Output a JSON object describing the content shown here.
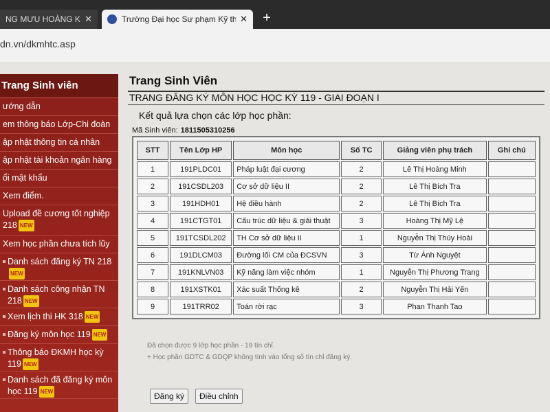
{
  "browser": {
    "tabs": [
      {
        "label": "NG MƯU HOÀNG KẾ -",
        "close": "✕"
      },
      {
        "label": "Trường Đại học Sư phạm Kỹ thuậ",
        "close": "✕"
      }
    ],
    "new_tab": "+",
    "url": "dn.vn/dkmhtc.asp"
  },
  "sidebar": {
    "title": "Trang Sinh viên",
    "items": [
      {
        "label": "ướng dẫn"
      },
      {
        "label": "em thông báo Lớp-Chi đoàn"
      },
      {
        "label": "ập nhật thông tin cá nhân"
      },
      {
        "label": "ập nhật tài khoản ngân hàng"
      },
      {
        "label": "ổi mật khẩu"
      },
      {
        "label": "Xem điểm."
      },
      {
        "label": "Upload đề cương tốt nghiệp 218",
        "new": "NEW"
      },
      {
        "label": "Xem học phần chưa tích lũy"
      },
      {
        "label": "Danh sách đăng ký TN 218",
        "new": "NEW"
      },
      {
        "label": "Danh sách công nhận TN 218",
        "new": "NEW"
      },
      {
        "label": "Xem lịch thi HK 318",
        "new": "NEW"
      },
      {
        "label": "Đăng ký môn học 119",
        "new": "NEW"
      },
      {
        "label": "Thông báo ĐKMH học kỳ 119",
        "new": "NEW"
      },
      {
        "label": "Danh sách đã đăng ký môn học 119",
        "new": "NEW"
      }
    ]
  },
  "main": {
    "title": "Trang Sinh Viên",
    "subtitle": "TRANG ĐĂNG KÝ MÔN HỌC HỌC KỲ 119 - GIAI ĐOẠN I",
    "result_label": "Kết quả lựa chọn các lớp học phần:",
    "student_id_label": "Mã Sinh viên:",
    "student_id": "1811505310256",
    "table": {
      "headers": [
        "STT",
        "Tên Lớp HP",
        "Môn học",
        "Số TC",
        "Giảng viên phụ trách",
        "Ghi chú"
      ],
      "rows": [
        {
          "stt": "1",
          "code": "191PLDC01",
          "subject": "Pháp luật đại cương",
          "credits": "2",
          "lecturer": "Lê Thị Hoàng Minh",
          "note": ""
        },
        {
          "stt": "2",
          "code": "191CSDL203",
          "subject": "Cơ sở dữ liệu II",
          "credits": "2",
          "lecturer": "Lê Thị Bích Tra",
          "note": ""
        },
        {
          "stt": "3",
          "code": "191HDH01",
          "subject": "Hệ điều hành",
          "credits": "2",
          "lecturer": "Lê Thị Bích Tra",
          "note": ""
        },
        {
          "stt": "4",
          "code": "191CTGT01",
          "subject": "Cấu trúc dữ liệu & giải thuật",
          "credits": "3",
          "lecturer": "Hoàng Thị Mỹ Lệ",
          "note": ""
        },
        {
          "stt": "5",
          "code": "191TCSDL202",
          "subject": "TH Cơ sở dữ liệu II",
          "credits": "1",
          "lecturer": "Nguyễn Thị Thúy Hoài",
          "note": ""
        },
        {
          "stt": "6",
          "code": "191DLCM03",
          "subject": "Đường lối CM của ĐCSVN",
          "credits": "3",
          "lecturer": "Từ Ánh Nguyệt",
          "note": ""
        },
        {
          "stt": "7",
          "code": "191KNLVN03",
          "subject": "Kỹ năng làm việc nhóm",
          "credits": "1",
          "lecturer": "Nguyễn Thị Phương Trang",
          "note": ""
        },
        {
          "stt": "8",
          "code": "191XSTK01",
          "subject": "Xác suất Thống kê",
          "credits": "2",
          "lecturer": "Nguyễn Thị Hải Yến",
          "note": ""
        },
        {
          "stt": "9",
          "code": "191TRR02",
          "subject": "Toán rời rạc",
          "credits": "3",
          "lecturer": "Phan Thanh Tao",
          "note": ""
        }
      ]
    },
    "summary": "Đã chọn được 9 lớp học phần - 19 tín chỉ.",
    "footnote": "+ Học phần GDTC & GDQP không tính vào tổng số tín chỉ đăng ký.",
    "buttons": {
      "register": "Đăng ký",
      "adjust": "Điều chỉnh"
    }
  }
}
